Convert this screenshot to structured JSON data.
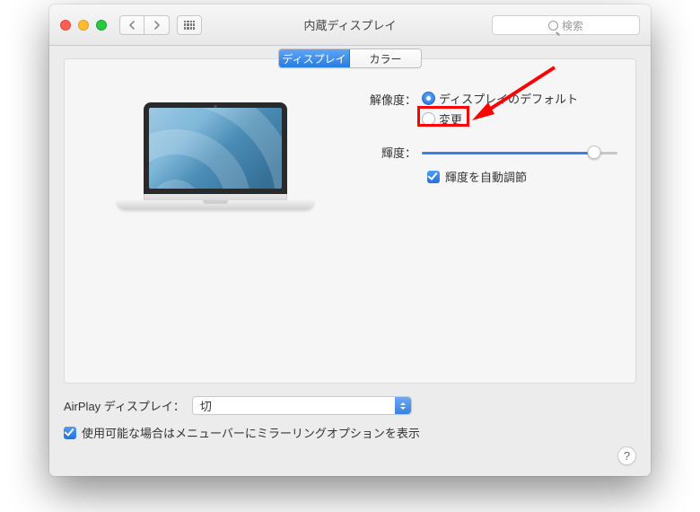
{
  "window": {
    "title": "内蔵ディスプレイ"
  },
  "search": {
    "placeholder": "検索"
  },
  "tabs": {
    "display": "ディスプレイ",
    "color": "カラー"
  },
  "resolution": {
    "label": "解像度：",
    "option_default": "ディスプレイのデフォルト",
    "option_scaled": "変更"
  },
  "brightness": {
    "label": "輝度：",
    "auto_label": "輝度を自動調節"
  },
  "airplay": {
    "label": "AirPlay ディスプレイ：",
    "value": "切"
  },
  "mirror": {
    "label": "使用可能な場合はメニューバーにミラーリングオプションを表示"
  },
  "help": {
    "glyph": "?"
  }
}
